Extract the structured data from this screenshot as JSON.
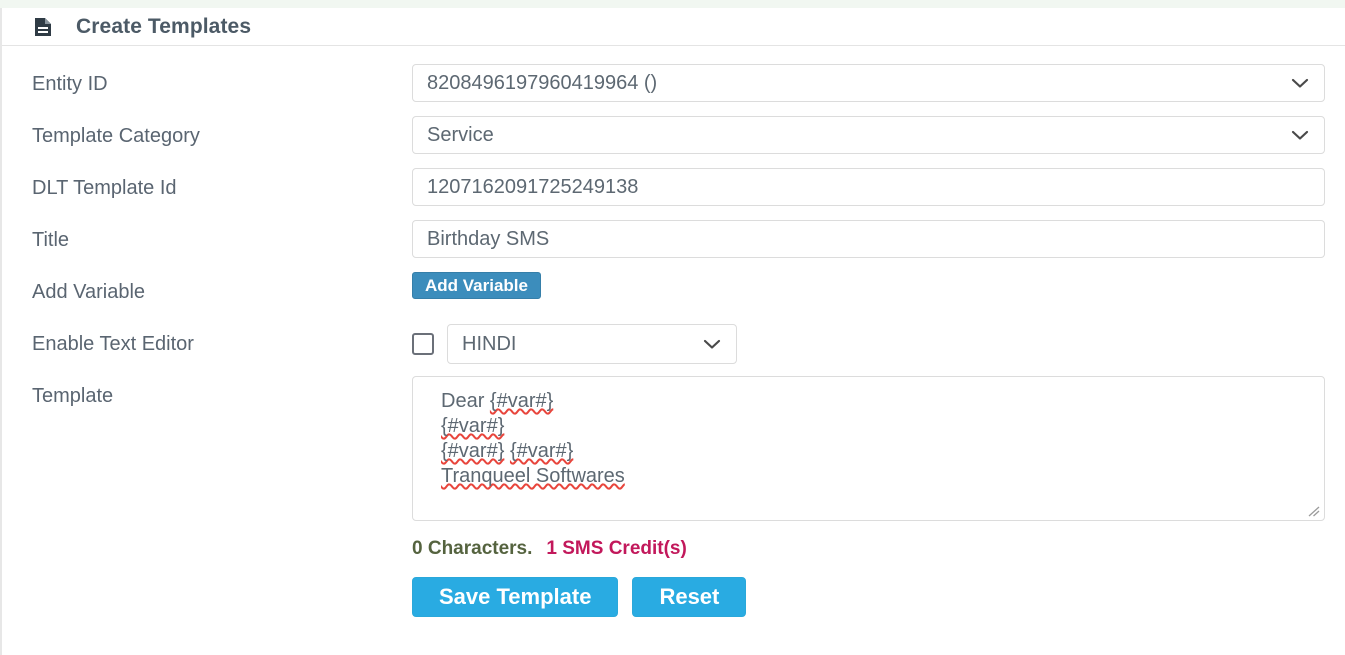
{
  "header": {
    "title": "Create Templates",
    "icon": "file-document-icon"
  },
  "form": {
    "entity_id": {
      "label": "Entity ID",
      "value": "8208496197960419964 ()",
      "icon": "chevron-down-icon"
    },
    "template_category": {
      "label": "Template Category",
      "value": "Service",
      "icon": "chevron-down-icon"
    },
    "dlt_template_id": {
      "label": "DLT Template Id",
      "value": "1207162091725249138"
    },
    "title": {
      "label": "Title",
      "value": "Birthday SMS"
    },
    "add_variable": {
      "label": "Add Variable",
      "button_label": "Add Variable"
    },
    "enable_text_editor": {
      "label": "Enable Text Editor",
      "checkbox_checked": "false",
      "language_value": "HINDI",
      "icon": "chevron-down-icon"
    },
    "template": {
      "label": "Template",
      "line1_prefix": "Dear ",
      "line1_var": "{#var#}",
      "line2_var": "{#var#}",
      "line3_var_a": "{#var#}",
      "line3_var_b": "{#var#}",
      "line4": "Tranqueel Softwares",
      "resize_icon": "resize-grip-icon"
    }
  },
  "counter": {
    "characters": "0 Characters.",
    "credits": "1 SMS Credit(s)"
  },
  "actions": {
    "save_label": "Save Template",
    "reset_label": "Reset"
  },
  "colors": {
    "add_variable_button": "#3c8dbc",
    "primary_button": "#29abe2",
    "credits_text": "#c2185b",
    "characters_text": "#55633f",
    "label_text": "#5a6571",
    "field_border": "#dcdcdc"
  }
}
